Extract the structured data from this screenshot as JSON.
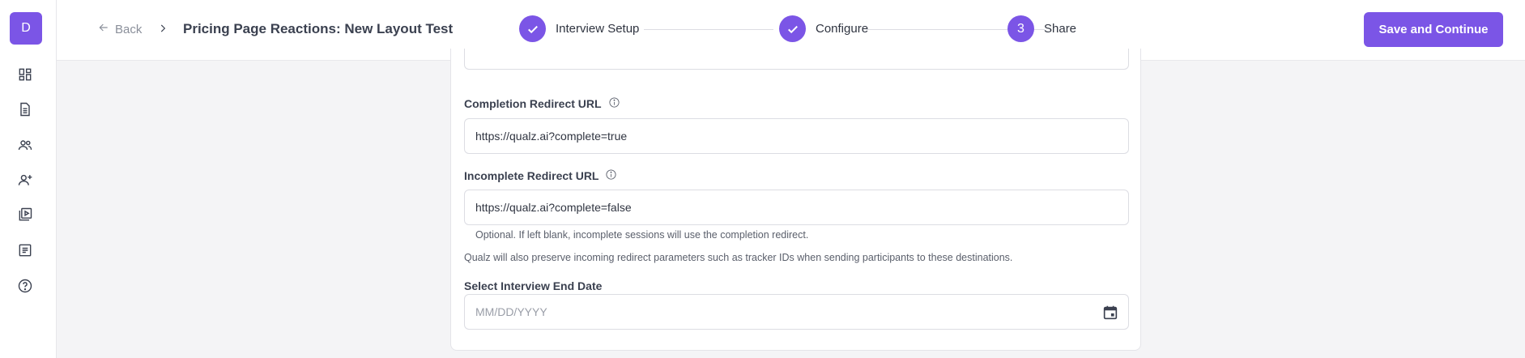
{
  "sidebar": {
    "avatar_letter": "D",
    "icons": [
      "dashboard-icon",
      "document-icon",
      "users-icon",
      "add-user-icon",
      "video-library-icon",
      "article-icon",
      "help-icon"
    ]
  },
  "header": {
    "back_label": "Back",
    "title": "Pricing Page Reactions: New Layout Test",
    "steps": [
      {
        "label": "Interview Setup",
        "status": "complete"
      },
      {
        "label": "Configure",
        "status": "complete"
      },
      {
        "label": "Share",
        "status": "current",
        "number": "3"
      }
    ],
    "save_label": "Save and Continue"
  },
  "form": {
    "completion_label": "Completion Redirect URL",
    "completion_value": "https://qualz.ai?complete=true",
    "incomplete_label": "Incomplete Redirect URL",
    "incomplete_value": "https://qualz.ai?complete=false",
    "incomplete_hint": "Optional. If left blank, incomplete sessions will use the completion redirect.",
    "preserve_note": "Qualz will also preserve incoming redirect parameters such as tracker IDs when sending participants to these destinations.",
    "end_date_label": "Select Interview End Date",
    "end_date_placeholder": "MM/DD/YYYY"
  },
  "colors": {
    "accent": "#7b55e6",
    "background": "#f4f4f6"
  }
}
